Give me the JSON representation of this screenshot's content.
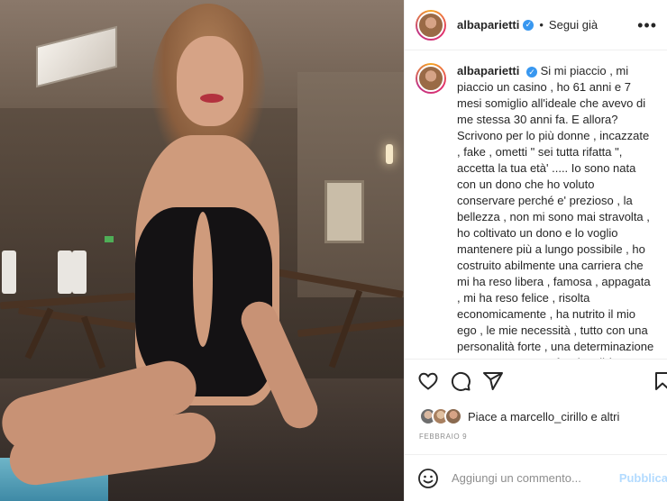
{
  "post": {
    "image_alt_subject": "",
    "username": "albaparietti",
    "follow_status": "Segui già",
    "separator": "•",
    "caption": "Si mi piaccio , mi piaccio un casino , ho 61 anni e 7 mesi somiglio all'ideale che avevo di me stessa 30 anni fa. E allora? Scrivono per lo più donne , incazzate , fake , ometti \" sei tutta rifatta \", accetta la tua età' ..... Io sono nata con un dono che ho voluto conservare perché e' prezioso , la bellezza , non mi sono mai stravolta , ho coltivato un dono e lo voglio mantenere più a lungo possibile , ho costruito abilmente una carriera che mi ha reso libera , famosa , appagata , mi ha reso felice , risolta economicamente , ha nutrito il mio ego , le mie necessità , tutto con una personalità forte , una determinazione pazzesca , una professionalità innegabile , un successo tangibile che",
    "likes_text": "Piace a marcello_cirillo e altri",
    "date": "FEBBRAIO 9",
    "comment_placeholder": "Aggiungi un commento...",
    "publish_label": "Pubblica"
  },
  "icons": {
    "verified": "verified-badge-icon",
    "more": "more-options-icon",
    "like": "heart-icon",
    "comment": "comment-icon",
    "share": "share-icon",
    "save": "bookmark-icon",
    "emoji": "emoji-icon"
  },
  "colors": {
    "verified": "#3897f0",
    "publish_disabled": "#b3dbff",
    "muted_text": "#8e8e8e"
  }
}
